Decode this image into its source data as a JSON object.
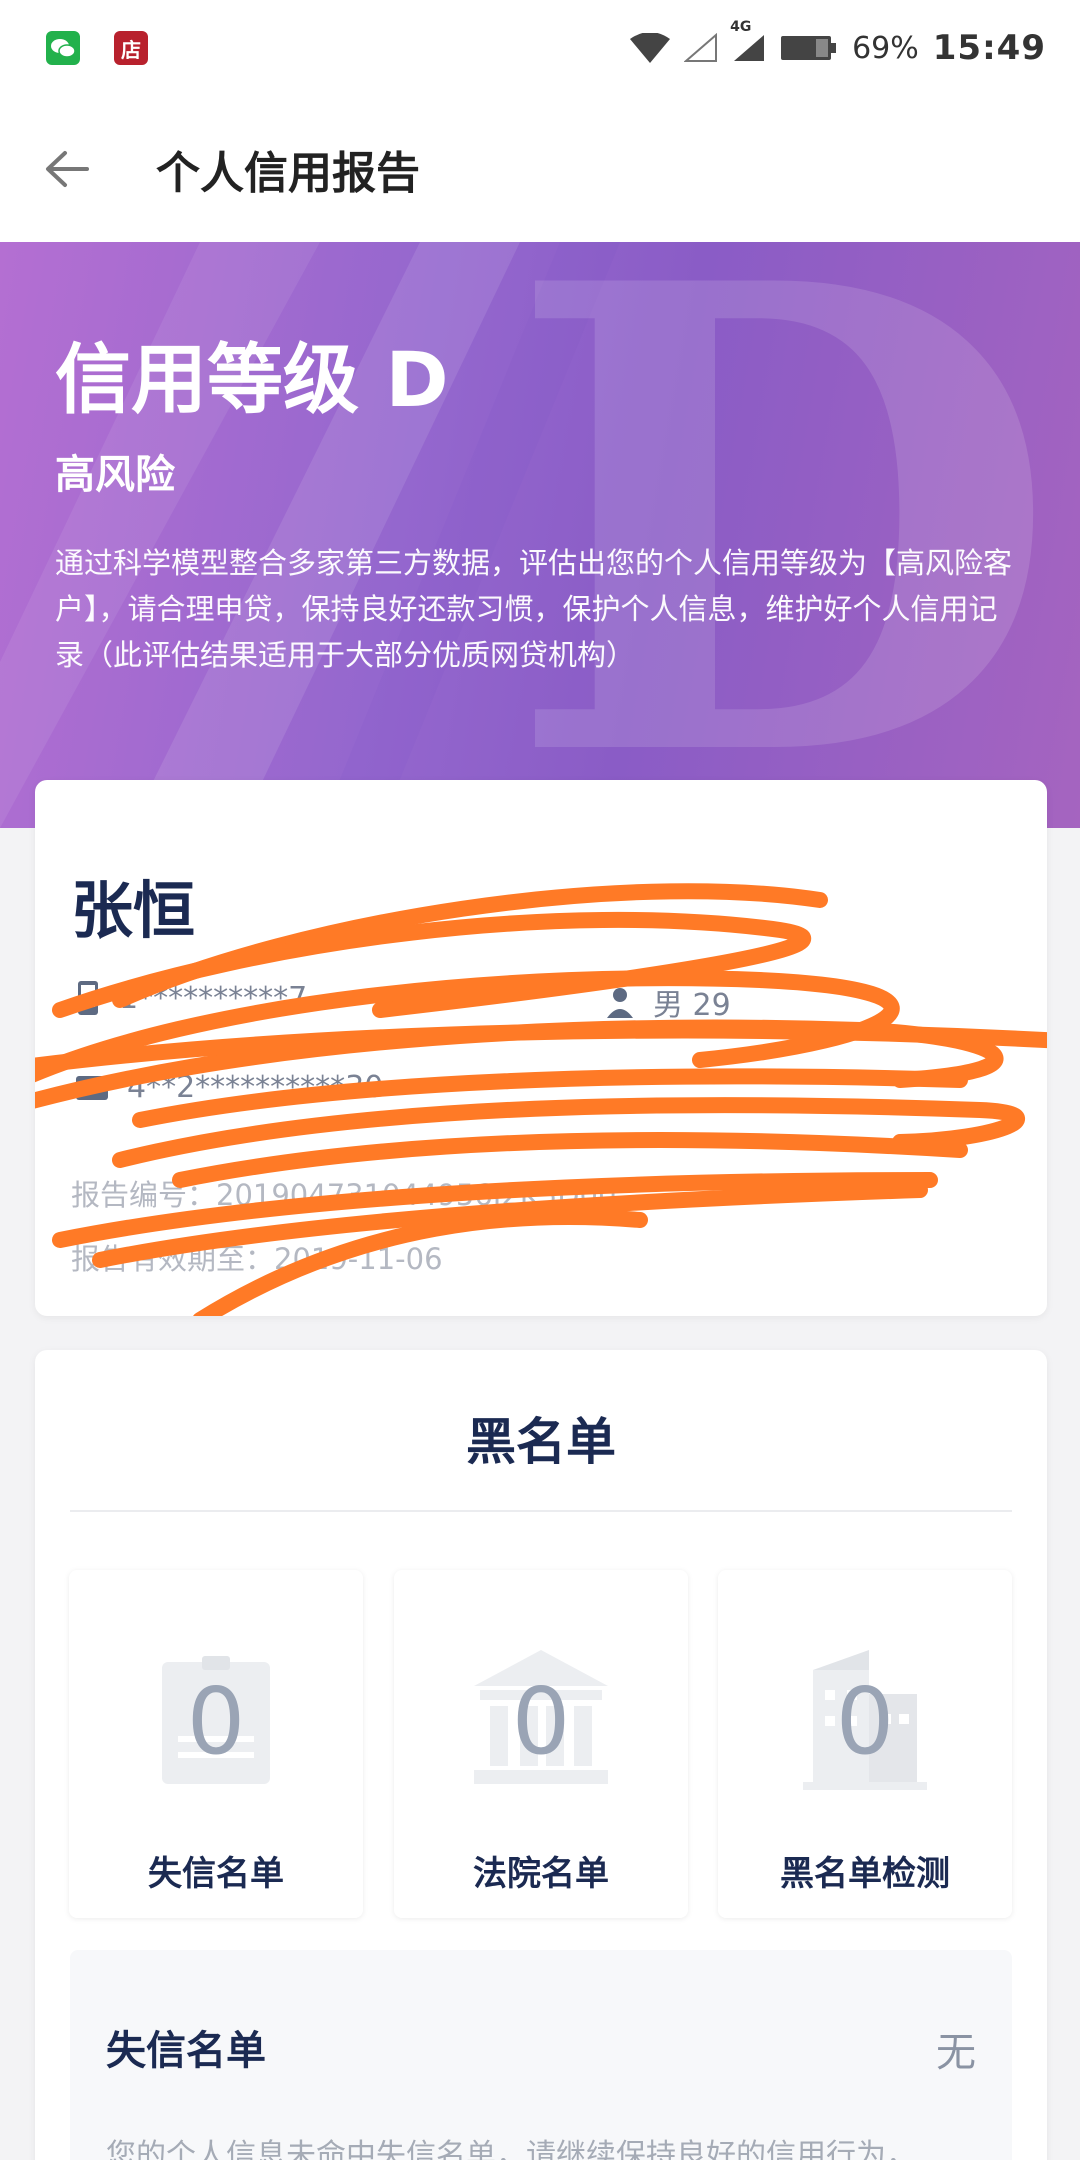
{
  "status_bar": {
    "icons": [
      "wechat-icon",
      "shop-icon"
    ],
    "shop_glyph": "店",
    "network_label": "4G",
    "battery": "69%",
    "time": "15:49"
  },
  "app_bar": {
    "title": "个人信用报告"
  },
  "hero": {
    "level_text": "信用等级 D",
    "watermark_letter": "D",
    "risk": "高风险",
    "description": "通过科学模型整合多家第三方数据，评估出您的个人信用等级为【高风险客户】，请合理申贷，保持良好还款习惯，保护个人信息，维护好个人信用记录（此评估结果适用于大部分优质网贷机构）"
  },
  "profile": {
    "name": "张恒",
    "phone": "1**********7",
    "gender": "男 29",
    "id_number": "4**2**********30",
    "report_no": "报告编号：201904731044956J2K5D00",
    "report_expiry": "报告有效期至：2019-11-06"
  },
  "blacklist": {
    "title": "黑名单",
    "tiles": [
      {
        "label": "失信名单",
        "count": "0",
        "icon": "id-card-icon"
      },
      {
        "label": "法院名单",
        "count": "0",
        "icon": "court-building-icon"
      },
      {
        "label": "黑名单检测",
        "count": "0",
        "icon": "office-building-icon"
      }
    ],
    "detail": {
      "title": "失信名单",
      "status": "无",
      "description": "您的个人信息未命中失信名单，请继续保持良好的信用行为，"
    }
  },
  "colors": {
    "accent_purple": "#9467ce",
    "scribble_orange": "#ff7a26",
    "text_navy": "#1b2a52"
  }
}
